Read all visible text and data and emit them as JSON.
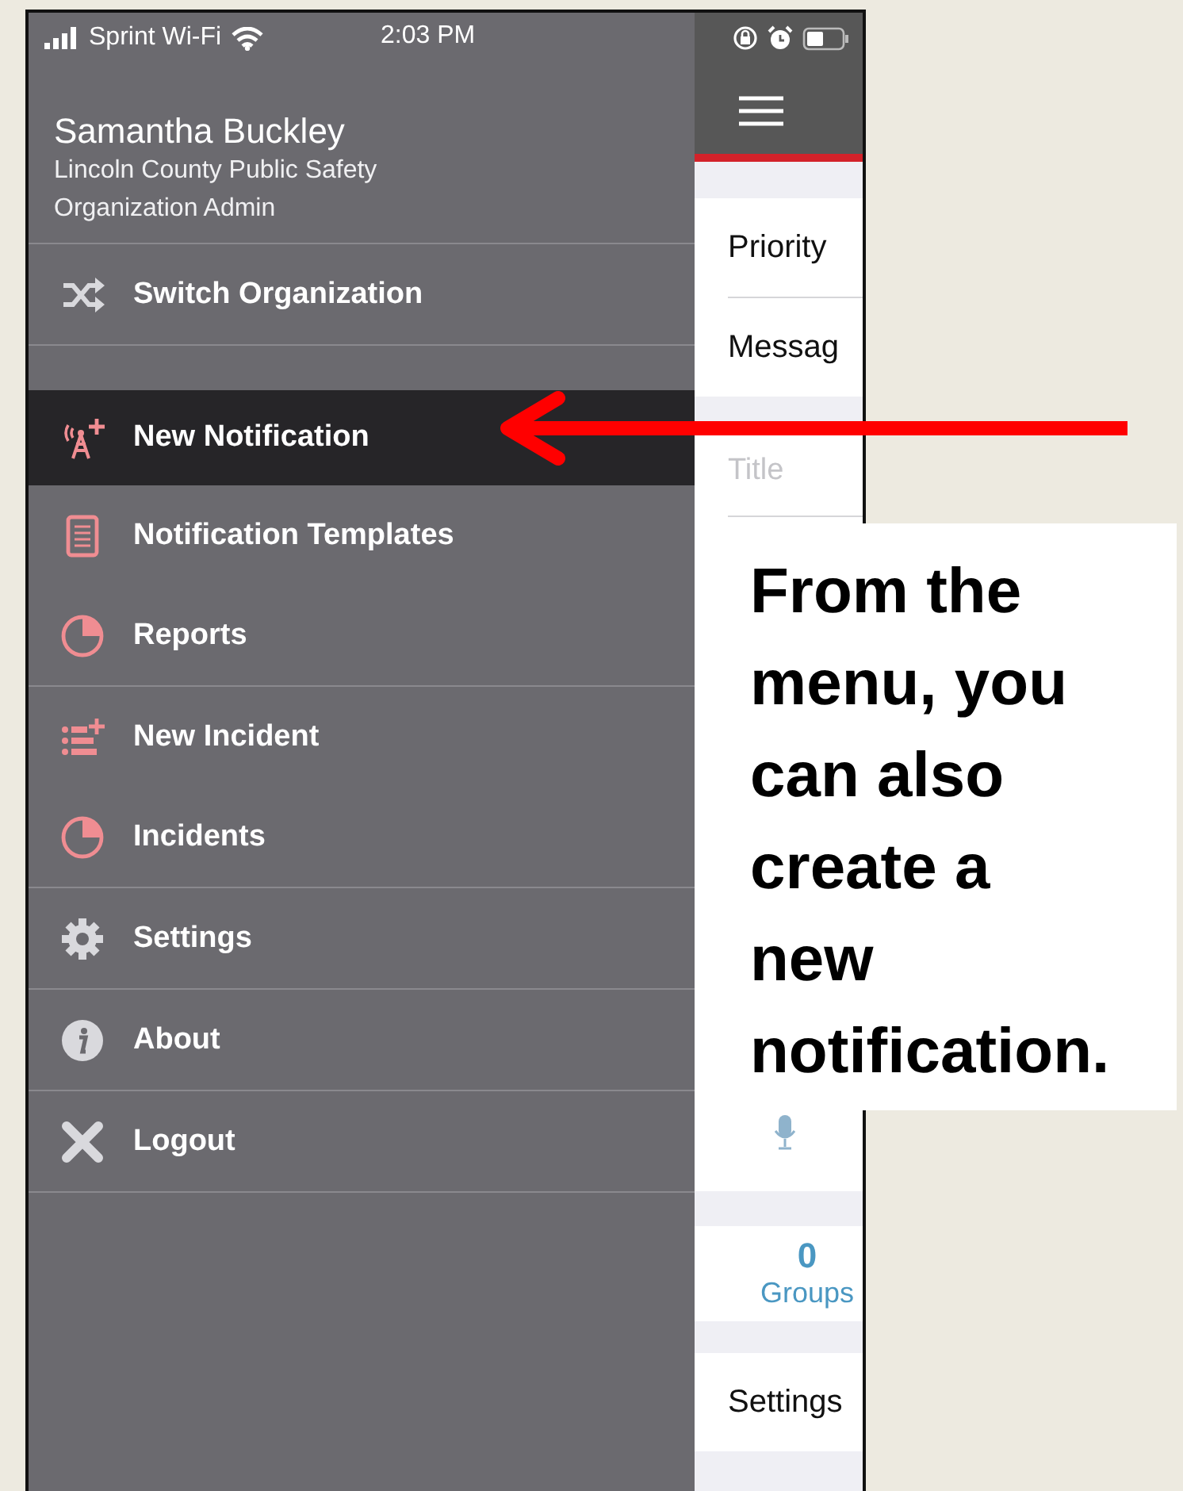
{
  "status_bar": {
    "carrier": "Sprint Wi-Fi",
    "time": "2:03 PM"
  },
  "drawer": {
    "user": {
      "name": "Samantha Buckley",
      "organization": "Lincoln County Public Safety",
      "role": "Organization Admin"
    },
    "groups": [
      {
        "items": [
          {
            "label": "Switch Organization",
            "kind": "shuffle",
            "selected": false
          }
        ]
      },
      {
        "items": [
          {
            "label": "New Notification",
            "kind": "tower",
            "selected": true
          },
          {
            "label": "Notification Templates",
            "kind": "document",
            "selected": false
          },
          {
            "label": "Reports",
            "kind": "pie",
            "selected": false
          }
        ]
      },
      {
        "items": [
          {
            "label": "New Incident",
            "kind": "list-plus",
            "selected": false
          },
          {
            "label": "Incidents",
            "kind": "pie",
            "selected": false
          }
        ]
      },
      {
        "items": [
          {
            "label": "Settings",
            "kind": "gear",
            "selected": false
          }
        ]
      },
      {
        "items": [
          {
            "label": "About",
            "kind": "info",
            "selected": false
          }
        ]
      },
      {
        "items": [
          {
            "label": "Logout",
            "kind": "cross",
            "selected": false
          }
        ]
      }
    ]
  },
  "main": {
    "sections": [
      {
        "rows": [
          {
            "kind": "field",
            "text": "Priority"
          },
          {
            "kind": "field",
            "text": "Messag"
          }
        ]
      },
      {
        "rows": [
          {
            "kind": "placeholder",
            "text": "Title"
          },
          {
            "kind": "mic"
          }
        ]
      },
      {
        "rows": [
          {
            "kind": "count",
            "value": "0",
            "label": "Groups"
          }
        ]
      },
      {
        "rows": [
          {
            "kind": "field",
            "text": "Settings"
          }
        ]
      }
    ]
  },
  "callout": {
    "text": "From the menu, you can also create a new notification."
  }
}
